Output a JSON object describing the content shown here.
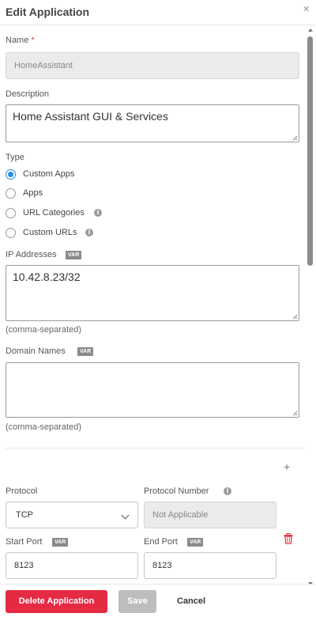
{
  "dialog": {
    "title": "Edit Application",
    "close_glyph": "×"
  },
  "form": {
    "name": {
      "label": "Name",
      "required_mark": "*",
      "value": "HomeAssistant"
    },
    "description": {
      "label": "Description",
      "value": "Home Assistant GUI & Services"
    },
    "type": {
      "label": "Type",
      "options": [
        {
          "label": "Custom Apps",
          "checked": true
        },
        {
          "label": "Apps",
          "checked": false
        },
        {
          "label": "URL Categories",
          "checked": false,
          "info": true
        },
        {
          "label": "Custom URLs",
          "checked": false,
          "info": true
        }
      ]
    },
    "ip_addresses": {
      "label": "IP Addresses",
      "badge": "VAR",
      "value": "10.42.8.23/32",
      "hint": "(comma-separated)"
    },
    "domain_names": {
      "label": "Domain Names",
      "badge": "VAR",
      "value": "",
      "hint": "(comma-separated)"
    },
    "add_glyph": "+",
    "protocol": {
      "label": "Protocol",
      "value": "TCP"
    },
    "protocol_number": {
      "label": "Protocol Number",
      "value": "Not Applicable"
    },
    "start_port": {
      "label": "Start Port",
      "badge": "VAR",
      "value": "8123"
    },
    "end_port": {
      "label": "End Port",
      "badge": "VAR",
      "value": "8123"
    },
    "info_glyph": "i"
  },
  "footer": {
    "delete_label": "Delete Application",
    "save_label": "Save",
    "cancel_label": "Cancel"
  },
  "colors": {
    "danger": "#e52a44",
    "radio_accent": "#2b8be0",
    "trash": "#e0303d",
    "disabled_bg": "#ebebeb"
  },
  "icons": [
    "close-icon",
    "info-icon",
    "plus-icon",
    "chevron-down-icon",
    "trash-icon"
  ]
}
